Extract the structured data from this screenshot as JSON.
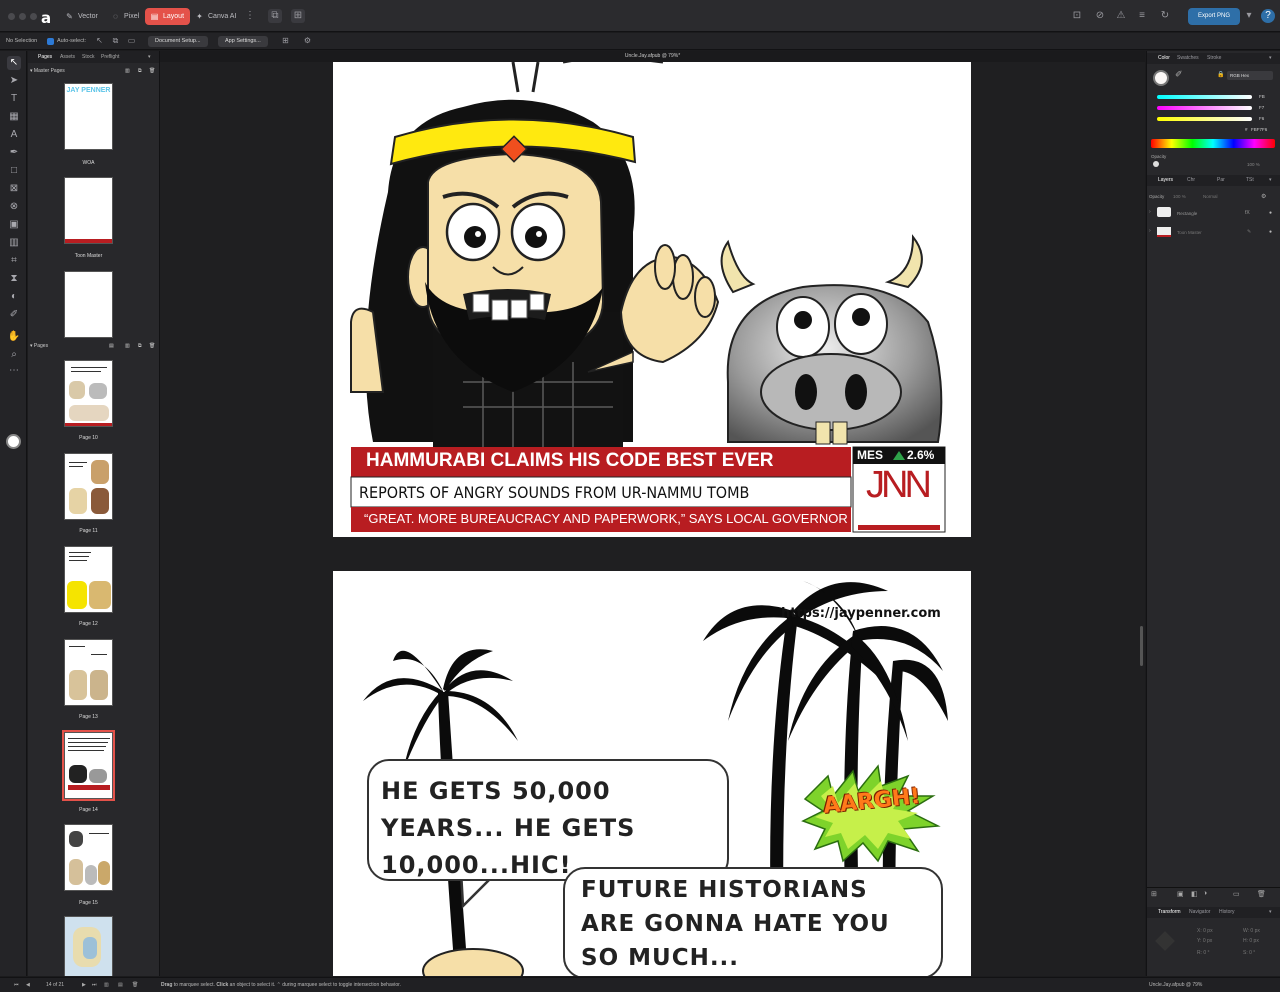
{
  "titlebar": {
    "personas": [
      "Vector",
      "Pixel",
      "Layout",
      "Canva AI"
    ],
    "active_persona": "Layout",
    "export_label": "Export PNG"
  },
  "context_toolbar": {
    "selection": "No Selection",
    "auto_select": "Auto-select:",
    "doc_setup": "Document Setup...",
    "app_settings": "App Settings..."
  },
  "left_panel": {
    "tabs": [
      "Pages",
      "Assets",
      "Stock",
      "Preflight"
    ],
    "master_pages_title": "Master Pages",
    "masters": [
      {
        "name": "WOA",
        "thumb_text": "JAY PENNER"
      },
      {
        "name": "Toon Master"
      },
      {
        "name": ""
      }
    ],
    "pages_title": "Pages",
    "pages": [
      {
        "name": "Page 10"
      },
      {
        "name": "Page 11"
      },
      {
        "name": "Page 12"
      },
      {
        "name": "Page 13"
      },
      {
        "name": "Page 14",
        "current": true
      },
      {
        "name": "Page 15"
      },
      {
        "name": ""
      }
    ]
  },
  "canvas": {
    "doc_title": "Uncle.Jay.afpub @ 79%*",
    "news": {
      "headline": "HAMMURABI CLAIMS HIS CODE BEST EVER",
      "subhead": "REPORTS OF ANGRY SOUNDS FROM UR-NAMMU TOMB",
      "quote": "“GREAT. MORE BUREAUCRACY AND PAPERWORK,” SAYS LOCAL GOVERNOR",
      "ticker": "MES",
      "change": "2.6%",
      "logo": "JNN"
    },
    "website": "https://jaypenner.com",
    "sfx": "AARGH!",
    "bubble1": [
      "HE GETS 50,000",
      "YEARS... HE GETS",
      "10,000...HIC!"
    ],
    "bubble2": [
      "FUTURE HISTORIANS",
      "ARE GONNA HATE YOU",
      "SO MUCH..."
    ]
  },
  "right_panel": {
    "tabs_top": [
      "Color",
      "Swatches",
      "Stroke"
    ],
    "color_mode": "RGB Hex",
    "rgb": [
      "FB",
      "F7",
      "F6"
    ],
    "hex": "FBF7F6",
    "opacity_label": "Opacity",
    "opacity_value": "100 %",
    "tabs_layers": [
      "Layers",
      "Chr",
      "Par",
      "TSt"
    ],
    "layers_opacity": "100 %",
    "blend_mode": "Normal",
    "layers": [
      {
        "name": "Rectangle",
        "fx": "fX"
      },
      {
        "name": "Toon Master"
      }
    ],
    "tabs_bottom": [
      "Transform",
      "Navigator",
      "History"
    ],
    "transform": {
      "x": "0 px",
      "y": "0 px",
      "w": "0 px",
      "h": "0 px",
      "r": "0 °",
      "s": "0 °"
    }
  },
  "status": {
    "page_indicator": "14 of 21",
    "hint_bold1": "Drag",
    "hint1": "to marquee select.",
    "hint_bold2": "Click",
    "hint2": "an object to select it. ⌃ during marquee select to toggle intersection behavior.",
    "right": "Uncle.Jay.afpub @ 79%"
  },
  "colors": {
    "accent": "#e4524a",
    "news_red": "#b81d21",
    "export_blue": "#2e6fa8",
    "headband_yellow": "#ffe90f"
  }
}
